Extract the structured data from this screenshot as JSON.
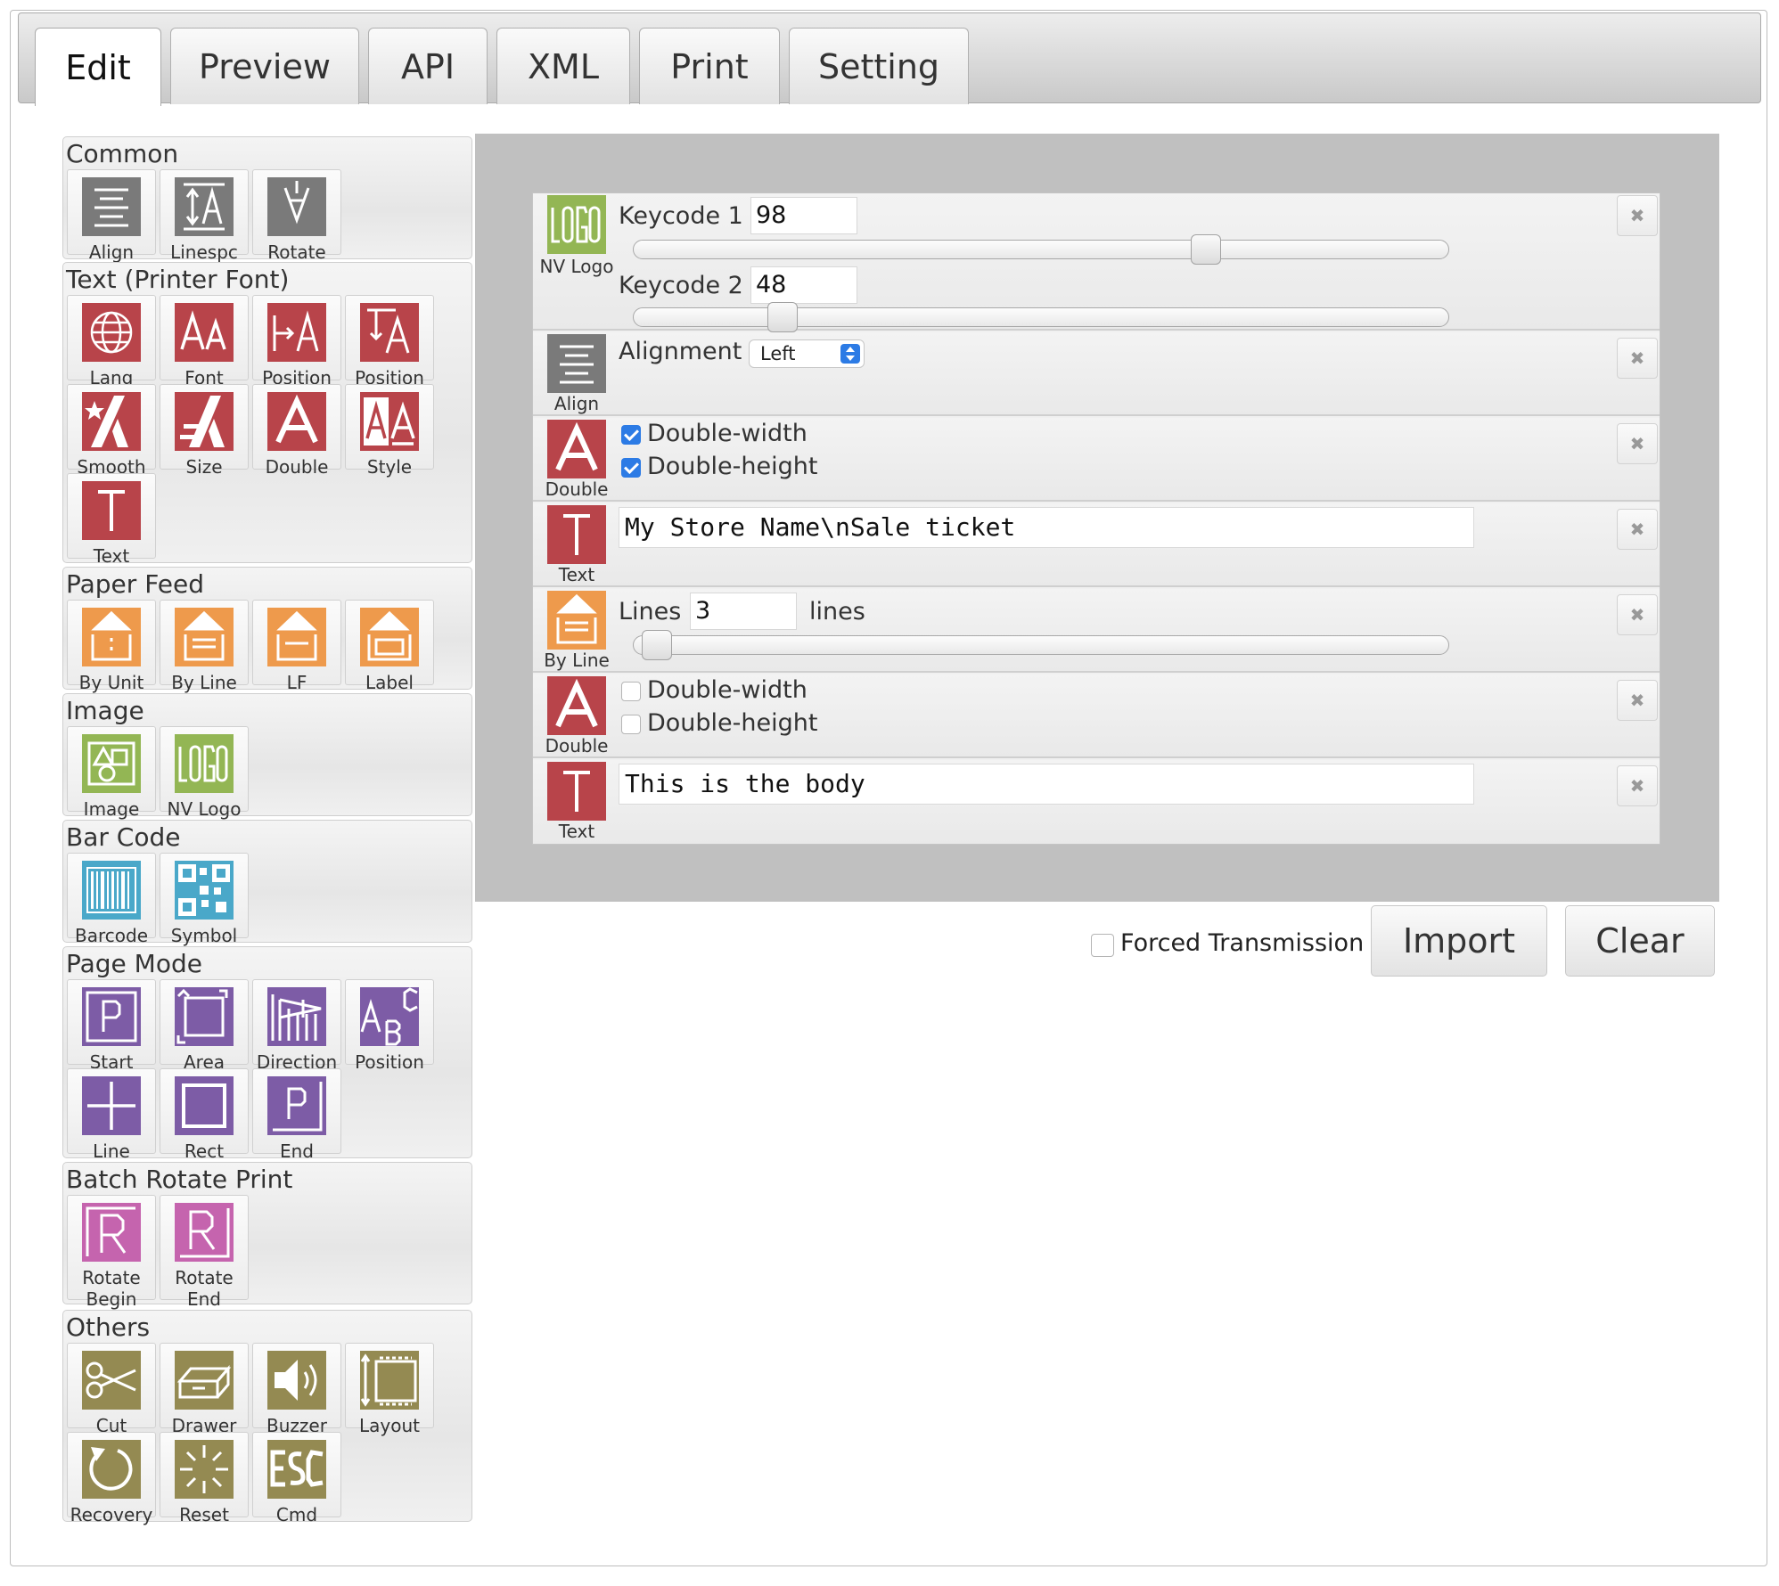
{
  "tabs": [
    {
      "label": "Edit",
      "active": true
    },
    {
      "label": "Preview"
    },
    {
      "label": "API"
    },
    {
      "label": "XML"
    },
    {
      "label": "Print"
    },
    {
      "label": "Setting"
    }
  ],
  "palette": {
    "common": {
      "title": "Common",
      "items": [
        "Align",
        "Linespc",
        "Rotate"
      ]
    },
    "text": {
      "title": "Text (Printer Font)",
      "items": [
        "Lang",
        "Font",
        "Position",
        "Position",
        "Smooth",
        "Size",
        "Double",
        "Style",
        "Text"
      ]
    },
    "paper_feed": {
      "title": "Paper Feed",
      "items": [
        "By Unit",
        "By Line",
        "LF",
        "Label"
      ]
    },
    "image": {
      "title": "Image",
      "items": [
        "Image",
        "NV Logo"
      ]
    },
    "barcode": {
      "title": "Bar Code",
      "items": [
        "Barcode",
        "Symbol"
      ]
    },
    "page_mode": {
      "title": "Page Mode",
      "items": [
        "Start",
        "Area",
        "Direction",
        "Position",
        "Line",
        "Rect",
        "End"
      ]
    },
    "batch_rotate": {
      "title": "Batch Rotate Print",
      "items": [
        "Rotate\nBegin",
        "Rotate\nEnd"
      ]
    },
    "others": {
      "title": "Others",
      "items": [
        "Cut",
        "Drawer",
        "Buzzer",
        "Layout",
        "Recovery",
        "Reset",
        "Cmd"
      ]
    }
  },
  "commands": {
    "nvlogo": {
      "label": "NV Logo",
      "keycode1_label": "Keycode 1",
      "keycode1": "98",
      "keycode1_level": 0.71,
      "keycode2_label": "Keycode 2",
      "keycode2": "48",
      "keycode2_level": 0.17
    },
    "align": {
      "label": "Align",
      "alignment_label": "Alignment",
      "alignment": "Left"
    },
    "double1": {
      "label": "Double",
      "dw_label": "Double-width",
      "dh_label": "Double-height",
      "dw": true,
      "dh": true
    },
    "text1": {
      "label": "Text",
      "value": "My Store Name\\nSale ticket"
    },
    "byline": {
      "label": "By Line",
      "lines_label": "Lines",
      "lines": "3",
      "unit": "lines",
      "level": 0.01
    },
    "double2": {
      "label": "Double",
      "dw_label": "Double-width",
      "dh_label": "Double-height",
      "dw": false,
      "dh": false
    },
    "text2": {
      "label": "Text",
      "value": "This is the body"
    }
  },
  "footer": {
    "forced_label": "Forced Transmission",
    "forced_checked": false,
    "import_label": "Import",
    "clear_label": "Clear"
  },
  "colors": {
    "gray": "#7a7a7a",
    "red": "#b8444a",
    "orange": "#ee9a4c",
    "green": "#93b654",
    "blue": "#4aa8c9",
    "purple": "#7d5ca6",
    "pink": "#c564ae",
    "olive": "#948a52"
  }
}
